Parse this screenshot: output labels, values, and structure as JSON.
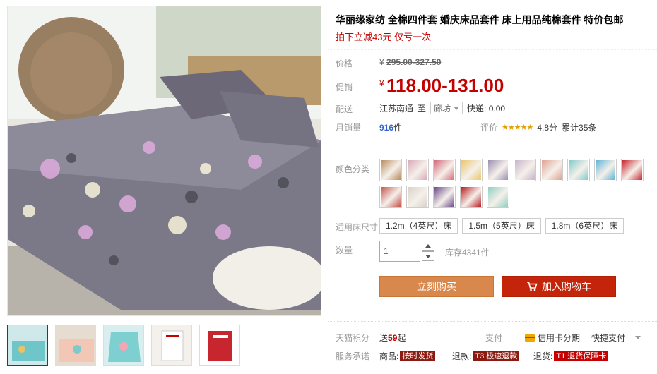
{
  "product": {
    "title": "华丽缘家纺 全棉四件套 婚庆床品套件 床上用品纯棉套件 特价包邮",
    "subtitle": "拍下立减43元 仅亏一次"
  },
  "price": {
    "label": "价格",
    "currency": "¥",
    "original": "295.00-327.50",
    "promo_label": "促销",
    "promo": "118.00-131.00"
  },
  "shipping": {
    "label": "配送",
    "origin": "江苏南通",
    "to": "至",
    "destination": "廊坊",
    "express": "快递: 0.00"
  },
  "sales": {
    "label": "月销量",
    "count": "916",
    "unit": "件",
    "review_label": "评价",
    "stars": "★★★★★",
    "score": "4.8分",
    "total": "累计35条"
  },
  "color": {
    "label": "颜色分类",
    "swatches": [
      "#b98a5c",
      "#d9a8b8",
      "#d46a7a",
      "#e8c66a",
      "#9a8fb0",
      "#c7b4c9",
      "#e0a090",
      "#7fc9c8",
      "#5ab3d6",
      "#c8262e",
      "#c2544c",
      "#d8d0c8",
      "#6a4a8a",
      "#b81e22",
      "#8fcfc0"
    ]
  },
  "size": {
    "label": "适用床尺寸",
    "options": [
      "1.2m（4英尺）床",
      "1.5m（5英尺）床",
      "1.8m（6英尺）床"
    ]
  },
  "quantity": {
    "label": "数量",
    "value": "1",
    "stock": "库存4341件"
  },
  "buttons": {
    "buy_now": "立刻购买",
    "add_cart": "加入购物车"
  },
  "footer": {
    "points_label": "天猫积分",
    "points_prefix": "送",
    "points_value": "59",
    "points_suffix": "起",
    "pay_label": "支付",
    "credit": "信用卡分期",
    "quick_pay": "快捷支付",
    "service_label": "服务承诺",
    "goods_label": "商品:",
    "goods_tag": "按时发货",
    "refund_label": "退款:",
    "refund_tag": "T3 极速退款",
    "return_label": "退货:",
    "return_tag": "T1 退货保障卡"
  }
}
